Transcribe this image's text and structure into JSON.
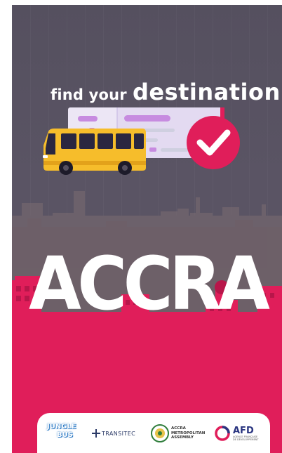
{
  "splash": {
    "headline_small": "find your",
    "headline_big": "destination",
    "city": "ACCRA"
  },
  "partners": {
    "junglebus_line1": "JUNGLE",
    "junglebus_line2": "BUS",
    "transitec": "TRANSITEC",
    "ama_line1": "ACCRA",
    "ama_line2": "METROPOLITAN",
    "ama_line3": "ASSEMBLY",
    "afd_name": "AFD",
    "afd_sub1": "AGENCE FRANÇAISE",
    "afd_sub2": "DE DÉVELOPPEMENT"
  },
  "colors": {
    "brand_pink": "#e01e5a",
    "sky": "#56505f",
    "bus_yellow": "#f6bd2b",
    "ticket_lavender": "#e9e1f4"
  },
  "icons": [
    "bus-icon",
    "ticket-icon",
    "checkmark-icon",
    "city-skyline"
  ]
}
